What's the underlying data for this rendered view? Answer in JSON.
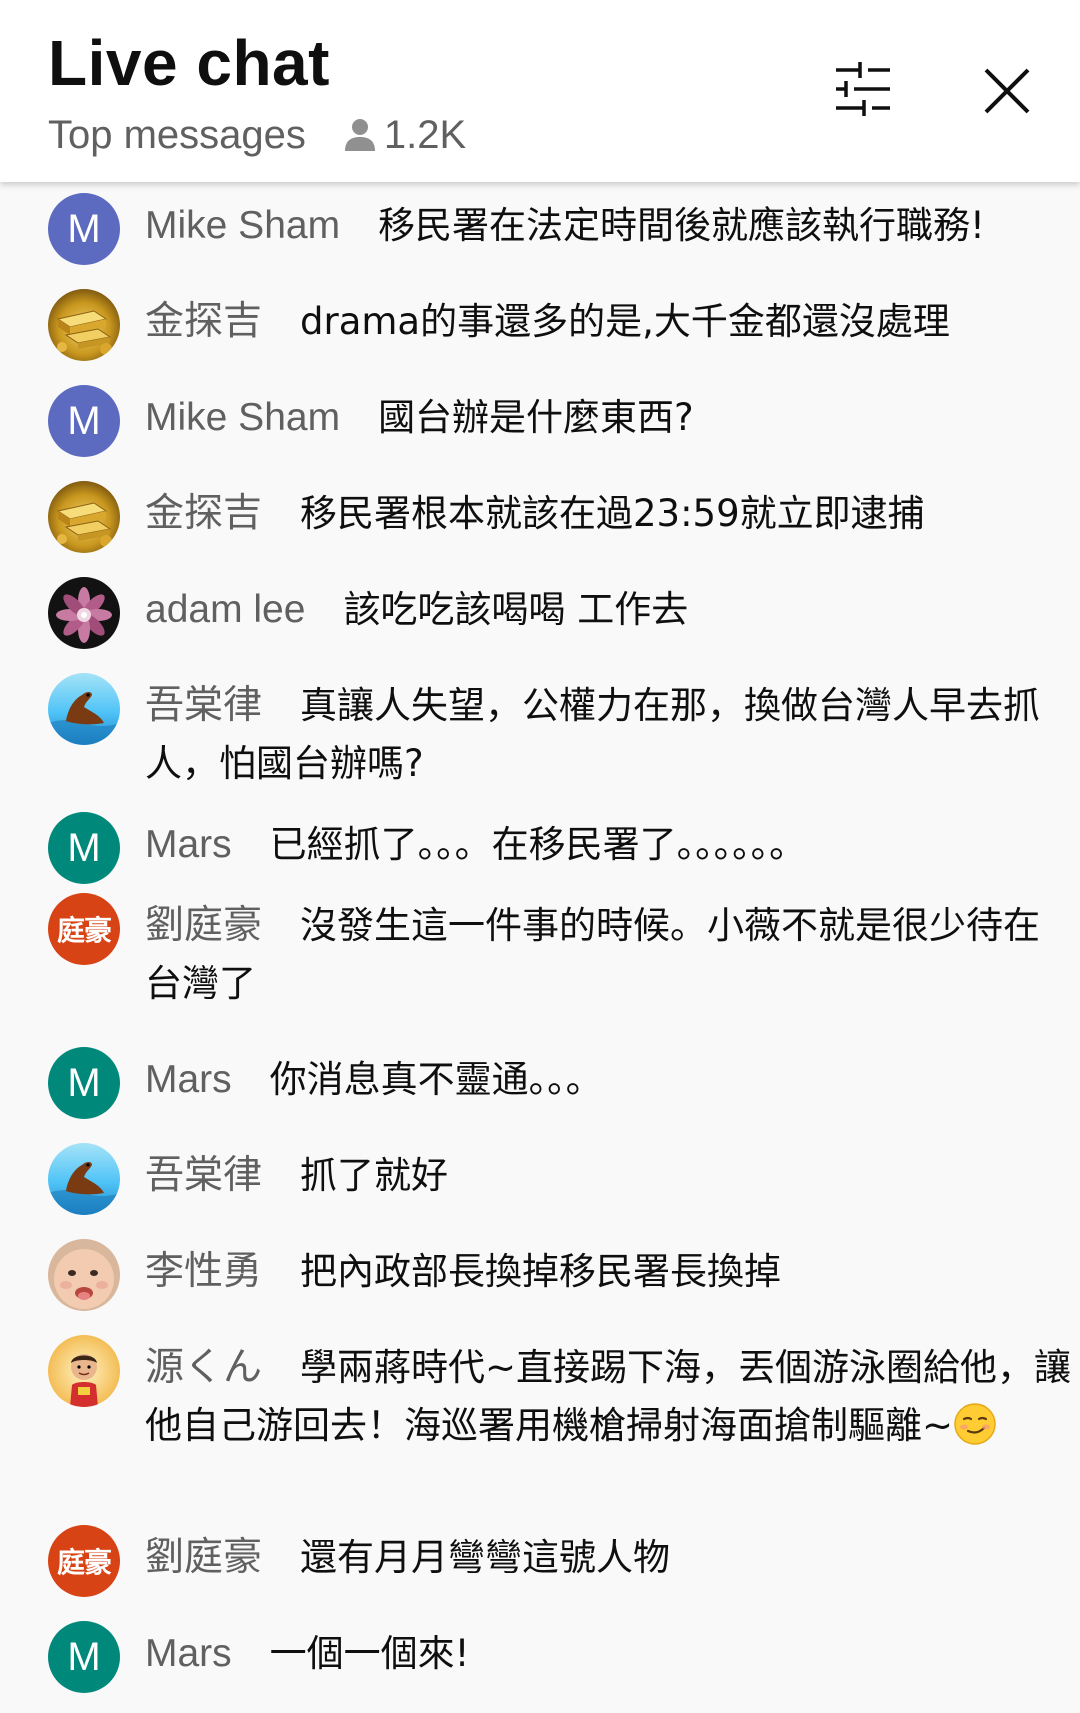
{
  "header": {
    "title": "Live chat",
    "mode": "Top messages",
    "viewer_count": "1.2K",
    "icons": [
      "person-icon",
      "filter-sliders-icon",
      "close-icon"
    ]
  },
  "messages": [
    {
      "author": "Mike Sham",
      "text": "移民署在法定時間後就應該執行職務!",
      "avatar": {
        "type": "letter",
        "letter": "M",
        "color": "#5c6bc0"
      }
    },
    {
      "author": "金探吉",
      "text": "drama的事還多的是,大千金都還沒處理",
      "avatar": {
        "type": "image",
        "image": "gold-bars",
        "color": "#b8860b"
      }
    },
    {
      "author": "Mike Sham",
      "text": "國台辦是什麼東西?",
      "avatar": {
        "type": "letter",
        "letter": "M",
        "color": "#5c6bc0"
      }
    },
    {
      "author": "金探吉",
      "text": "移民署根本就該在過23:59就立即逮捕",
      "avatar": {
        "type": "image",
        "image": "gold-bars",
        "color": "#b8860b"
      }
    },
    {
      "author": "adam lee",
      "text": "該吃吃該喝喝 工作去",
      "avatar": {
        "type": "image",
        "image": "flower",
        "color": "#1a1a1a"
      }
    },
    {
      "author": "吾棠律",
      "text": "真讓人失望，公權力在那，換做台灣人早去抓人，怕國台辦嗎?",
      "avatar": {
        "type": "image",
        "image": "sea-lion",
        "color": "#4fc3f7"
      }
    },
    {
      "author": "Mars",
      "text": "已經抓了。。。在移民署了。。。。。。",
      "avatar": {
        "type": "letter",
        "letter": "M",
        "color": "#00897b"
      }
    },
    {
      "author": "劉庭豪",
      "text": "沒發生這一件事的時候。小薇不就是很少待在台灣了",
      "avatar": {
        "type": "kanji",
        "letter": "庭豪",
        "color": "#d84315"
      }
    },
    {
      "author": "Mars",
      "text": "你消息真不靈通。。。",
      "avatar": {
        "type": "letter",
        "letter": "M",
        "color": "#00897b"
      }
    },
    {
      "author": "吾棠律",
      "text": "抓了就好",
      "avatar": {
        "type": "image",
        "image": "sea-lion",
        "color": "#4fc3f7"
      }
    },
    {
      "author": "李性勇",
      "text": "把內政部長換掉移民署長換掉",
      "avatar": {
        "type": "image",
        "image": "baby-face",
        "color": "#f0c8a8"
      }
    },
    {
      "author": "源くん",
      "text": "學兩蔣時代~直接踢下海，丟個游泳圈給他，讓他自己游回去！海巡署用機槍掃射海面搶制驅離~",
      "emoji": "smirking-face",
      "avatar": {
        "type": "image",
        "image": "cartoon-boy",
        "color": "#f5c26b"
      }
    },
    {
      "author": "劉庭豪",
      "text": "還有月月彎彎這號人物",
      "avatar": {
        "type": "kanji",
        "letter": "庭豪",
        "color": "#d84315"
      }
    },
    {
      "author": "Mars",
      "text": "一個一個來!",
      "avatar": {
        "type": "letter",
        "letter": "M",
        "color": "#00897b"
      }
    }
  ]
}
